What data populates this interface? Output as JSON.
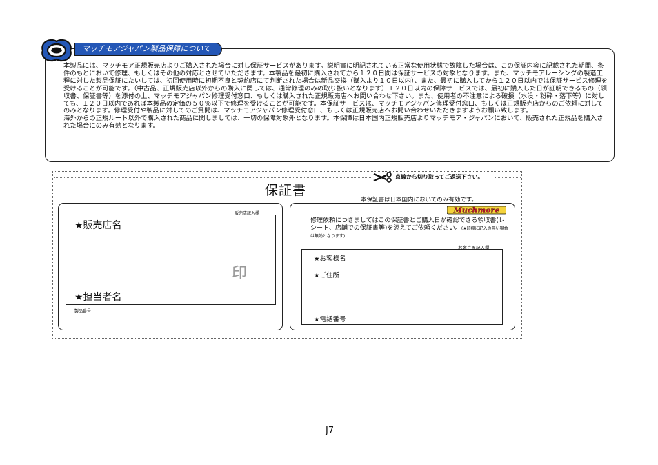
{
  "notice": {
    "heading": "マッチモアジャパン製品保障について",
    "paragraphs": [
      "本製品には、マッチモア正規販売店よりご購入された場合に対し保証サービスがあります。説明書に明記されている正常な使用状態で故障した場合は、この保証内容に記載された期間、条件のもとにおいて修理、もしくはその他の対応とさせていただきます。本製品を最初に購入されてから１２０日間は保証サービスの対象となります。また、マッチモアレーシングの製造工程に対した製品保証にたいしては、初回使用時に初期不良と契約店にて判断された場合は新品交換（購入より１０日以内）、また、最初に購入してから１２０日以内では保証サービス修理を受けることが可能です。（中古品、正規販売店以外からの購入に関しては、通常修理のみの取り扱いとなります）１２０日以内の保障サービスでは、最初に購入した日が証明できるもの（領収書、保証書等）を添付の上、マッチモアジャパン修理受付窓口、もしくは購入された正規販売店へお問い合わせ下さい。また、使用者の不注意による破損（水没・粉砕・落下等）に対しても、１２０日以内であれば本製品の定価の５０％以下で修理を受けることが可能です。本保証サービスは、マッチモアジャパン修理受付窓口、もしくは正規販売店からのご依頼に対してのみとなります。修理受付や製品に対してのご質問は、マッチモアジャパン修理受付窓口、もしくは正規販売店へお問い合わせいただきますようお願い致します。",
      "海外からの正規ルート以外で購入された商品に関しましては、一切の保障対象外となります。本保障は日本国内正規販売店よりマッチモア・ジャパンにおいて、販売された正規品を購入された場合にのみ有効となります。"
    ]
  },
  "card": {
    "cut_instruction": "点線から切り取ってご返送下さい。",
    "title": "保証書",
    "subtitle": "本保証書は日本国内においてのみ有効です。",
    "left": {
      "caption": "販売店記入欄",
      "store_label": "★販売店名",
      "seal": "印",
      "staff_label": "★担当者名",
      "serial_label": "製品番号"
    },
    "right": {
      "brand": "Muchmore",
      "request_text": "修理依頼につきましてはこの保証書とご購入日が確認できる領収書(レシート、店舗での保証書等)を添えてご依頼ください。",
      "request_note": "(★印欄に記入の無い場合は無効となります)",
      "caption": "お客さま記入欄",
      "name_label": "★お客様名",
      "address_label": "★ご住所",
      "phone_label": "★電話番号"
    }
  },
  "page_number": "J7",
  "colors": {
    "tab_blue": "#2457b6",
    "brand_red": "#c8102e"
  }
}
